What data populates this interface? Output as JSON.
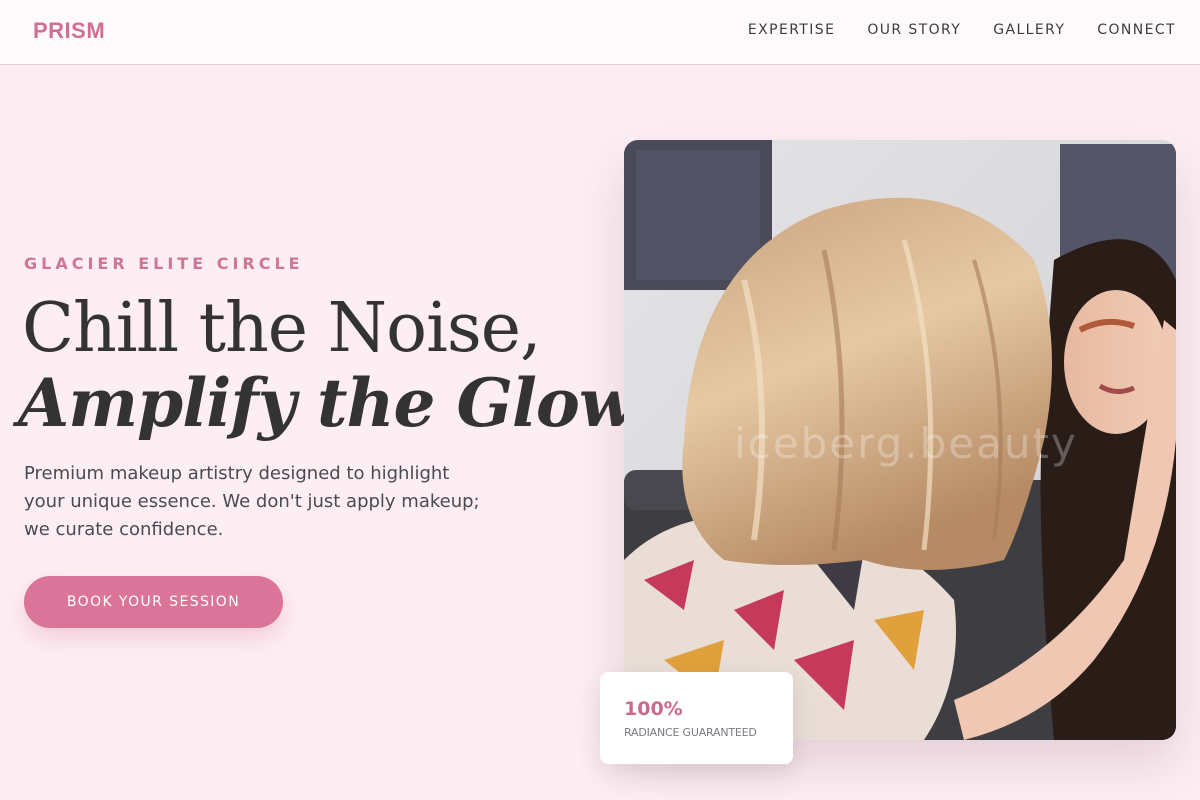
{
  "brand": {
    "logo": "PRISM"
  },
  "nav": {
    "items": [
      {
        "label": "EXPERTISE"
      },
      {
        "label": "OUR STORY"
      },
      {
        "label": "GALLERY"
      },
      {
        "label": "CONNECT"
      }
    ]
  },
  "hero": {
    "eyebrow": "GLACIER ELITE CIRCLE",
    "headline_line1": "Chill the Noise,",
    "headline_line2": "Amplify the Glow.",
    "lead": "Premium makeup artistry designed to highlight your unique essence. We don't just apply makeup; we curate confidence.",
    "cta_label": "BOOK YOUR SESSION",
    "photo_watermark": "iceberg.beauty"
  },
  "stat": {
    "value": "100%",
    "label": "RADIANCE GUARANTEED"
  },
  "colors": {
    "accent": "#da7498",
    "background": "#fdeef3",
    "heading": "#333333"
  }
}
